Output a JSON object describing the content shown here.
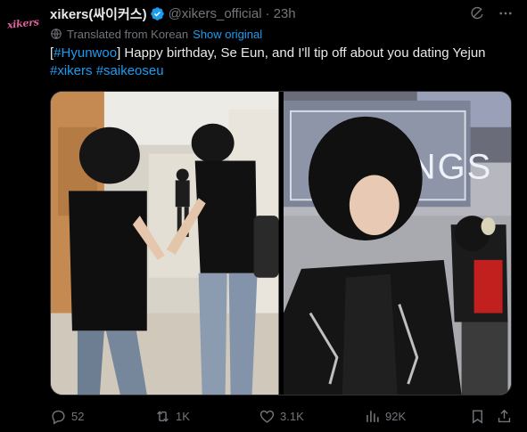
{
  "author": {
    "avatar_text": "xikers",
    "display_name": "xikers(싸이커스)",
    "handle": "@xikers_official",
    "separator": "·",
    "time": "23h"
  },
  "translation": {
    "label": "Translated from Korean",
    "show_original": "Show original"
  },
  "tweet": {
    "bracket_open": "[",
    "hashtag_hyunwoo": "#Hyunwoo",
    "text_main": "] Happy birthday, Se Eun, and I'll tip off about you dating Yejun",
    "hashtag_xikers": "#xikers",
    "hashtag_saikeoseu": "#saikeoseu"
  },
  "media": {
    "photo2_sign_text": "ORT NGS"
  },
  "actions": {
    "replies": "52",
    "reposts": "1K",
    "likes": "3.1K",
    "views": "92K"
  },
  "colors": {
    "accent": "#1d9bf0",
    "muted": "#71767b",
    "text": "#e7e9ea",
    "background": "#000000"
  },
  "icons": [
    "verified-badge-icon",
    "grok-icon",
    "more-icon",
    "globe-icon",
    "reply-icon",
    "repost-icon",
    "like-icon",
    "views-icon",
    "bookmark-icon",
    "share-icon"
  ]
}
